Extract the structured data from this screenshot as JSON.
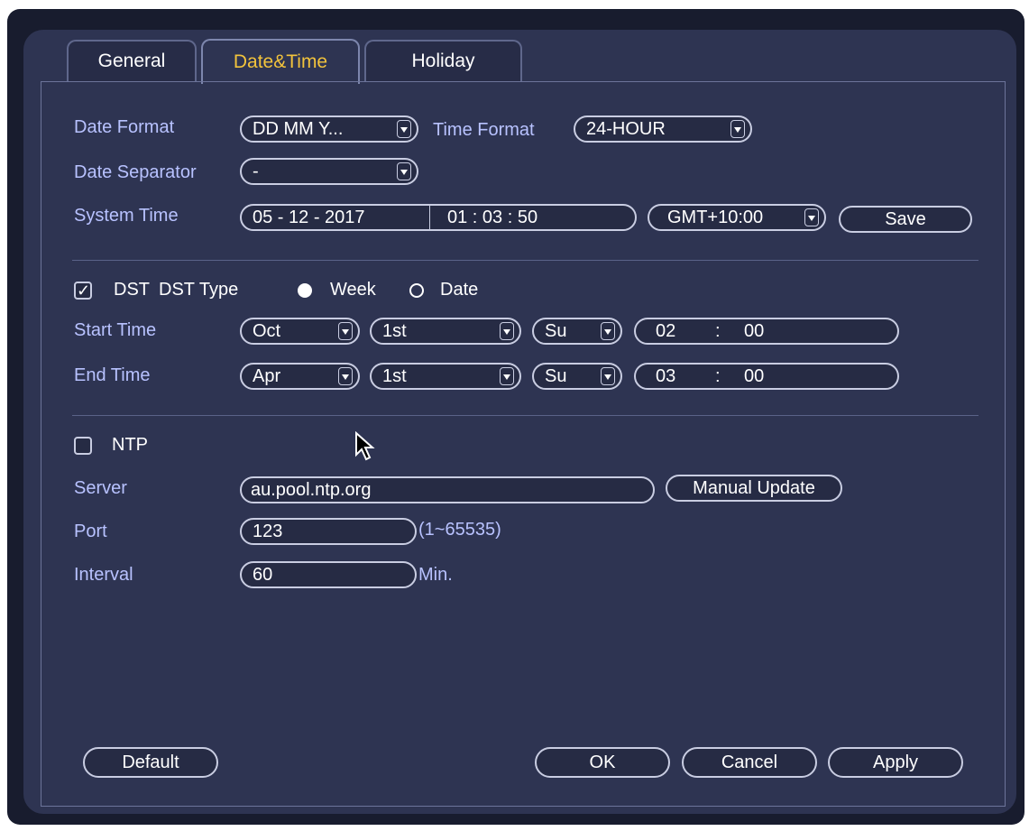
{
  "tabs": [
    "General",
    "Date&Time",
    "Holiday"
  ],
  "active_tab": "Date&Time",
  "date_format": {
    "label": "Date Format",
    "value": "DD MM Y..."
  },
  "time_format": {
    "label": "Time Format",
    "value": "24-HOUR"
  },
  "date_separator": {
    "label": "Date Separator",
    "value": "-"
  },
  "system_time": {
    "label": "System Time",
    "date": "05 - 12 - 2017",
    "time": "01 : 03 : 50",
    "timezone": "GMT+10:00",
    "save_label": "Save"
  },
  "dst": {
    "label": "DST",
    "checked": true,
    "type_label": "DST Type",
    "week_label": "Week",
    "date_label": "Date",
    "selected_type": "Week",
    "start": {
      "label": "Start Time",
      "month": "Oct",
      "week": "1st",
      "day": "Su",
      "hour": "02",
      "minute": "00"
    },
    "end": {
      "label": "End Time",
      "month": "Apr",
      "week": "1st",
      "day": "Su",
      "hour": "03",
      "minute": "00"
    }
  },
  "ntp": {
    "label": "NTP",
    "checked": false,
    "server_label": "Server",
    "server": "au.pool.ntp.org",
    "manual_update_label": "Manual Update",
    "port_label": "Port",
    "port": "123",
    "port_range": "(1~65535)",
    "interval_label": "Interval",
    "interval": "60",
    "interval_unit": "Min."
  },
  "buttons": {
    "default": "Default",
    "ok": "OK",
    "cancel": "Cancel",
    "apply": "Apply"
  },
  "colors": {
    "label": "#b8c2ff",
    "active_tab": "#f2c33c",
    "panel": "#2e3452",
    "background": "#181c2e"
  }
}
